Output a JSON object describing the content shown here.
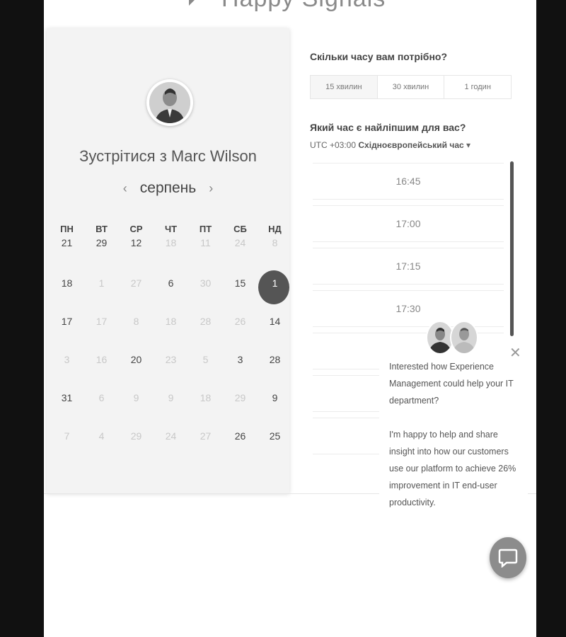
{
  "logo": {
    "text": "Happy Signals"
  },
  "calendar": {
    "meet_title": "Зустрітися з Marc Wilson",
    "month": "серпень",
    "prev_arrow": "‹",
    "next_arrow": "›",
    "weekdays": [
      "ПН",
      "ВТ",
      "СР",
      "ЧТ",
      "ПТ",
      "СБ",
      "НД"
    ],
    "weeks": [
      [
        {
          "d": "21",
          "s": "on"
        },
        {
          "d": "29",
          "s": "on"
        },
        {
          "d": "12",
          "s": "on"
        },
        {
          "d": "18",
          "s": "off"
        },
        {
          "d": "11",
          "s": "off"
        },
        {
          "d": "24",
          "s": "off"
        },
        {
          "d": "8",
          "s": "off"
        }
      ],
      [
        {
          "d": "18",
          "s": "on"
        },
        {
          "d": "1",
          "s": "off"
        },
        {
          "d": "27",
          "s": "off"
        },
        {
          "d": "6",
          "s": "on"
        },
        {
          "d": "30",
          "s": "off"
        },
        {
          "d": "15",
          "s": "on"
        },
        {
          "d": "1",
          "s": "sel"
        }
      ],
      [
        {
          "d": "17",
          "s": "on"
        },
        {
          "d": "17",
          "s": "off"
        },
        {
          "d": "8",
          "s": "off"
        },
        {
          "d": "18",
          "s": "off"
        },
        {
          "d": "28",
          "s": "off"
        },
        {
          "d": "26",
          "s": "off"
        },
        {
          "d": "14",
          "s": "on"
        }
      ],
      [
        {
          "d": "3",
          "s": "off"
        },
        {
          "d": "16",
          "s": "off"
        },
        {
          "d": "20",
          "s": "on"
        },
        {
          "d": "23",
          "s": "off"
        },
        {
          "d": "5",
          "s": "off"
        },
        {
          "d": "3",
          "s": "on"
        },
        {
          "d": "28",
          "s": "on"
        }
      ],
      [
        {
          "d": "31",
          "s": "on"
        },
        {
          "d": "6",
          "s": "off"
        },
        {
          "d": "9",
          "s": "off"
        },
        {
          "d": "9",
          "s": "off"
        },
        {
          "d": "18",
          "s": "off"
        },
        {
          "d": "29",
          "s": "off"
        },
        {
          "d": "9",
          "s": "on"
        }
      ],
      [
        {
          "d": "7",
          "s": "off"
        },
        {
          "d": "4",
          "s": "off"
        },
        {
          "d": "29",
          "s": "off"
        },
        {
          "d": "24",
          "s": "off"
        },
        {
          "d": "27",
          "s": "off"
        },
        {
          "d": "26",
          "s": "on"
        },
        {
          "d": "25",
          "s": "on"
        }
      ]
    ]
  },
  "booking": {
    "duration_question": "Скільки часу вам потрібно?",
    "durations": [
      {
        "label": "15 хвилин",
        "active": true
      },
      {
        "label": "30 хвилин",
        "active": false
      },
      {
        "label": "1 годин",
        "active": false
      }
    ],
    "time_question": "Який час є найліпшим для вас?",
    "timezone_prefix": "UTC +03:00",
    "timezone_name": "Східноєвропейський час",
    "timezone_caret": "▾",
    "slots": [
      "16:45",
      "17:00",
      "17:15",
      "17:30"
    ]
  },
  "popup": {
    "close": "✕",
    "para1": "Interested how Experience Management could help your IT department?",
    "para2": "I'm happy to help and share insight into how our customers use our platform to achieve 26% improvement in IT end-user productivity."
  },
  "icons": {
    "chat": "chat-bubble-icon",
    "close": "close-icon"
  }
}
